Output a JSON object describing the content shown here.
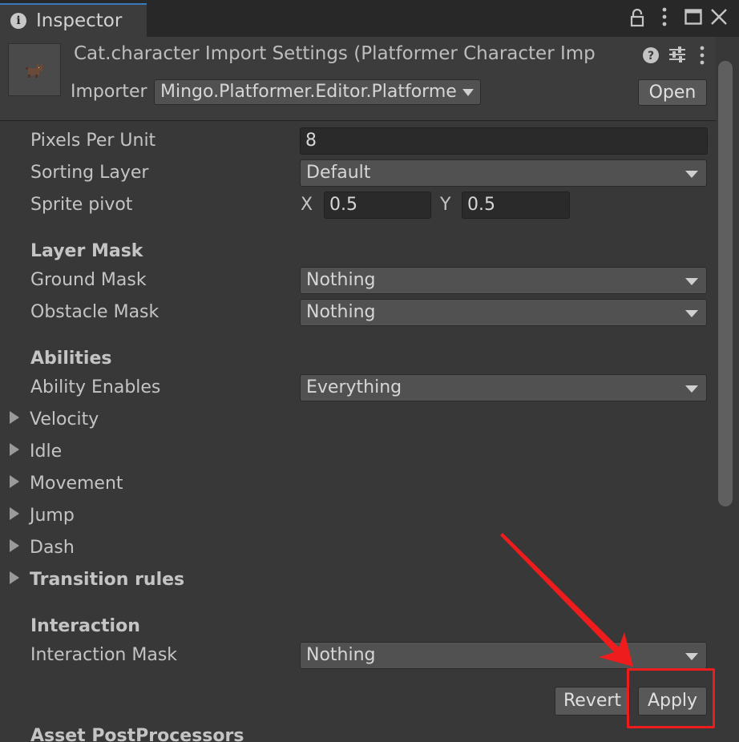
{
  "tab": {
    "title": "Inspector",
    "icon": "info-icon"
  },
  "toolbar_icons": [
    "lock-icon",
    "kebab-menu-icon",
    "maximize-icon",
    "close-icon"
  ],
  "header": {
    "title": "Cat.character Import Settings (Platformer Character Imp",
    "importer_label": "Importer",
    "importer_value": "Mingo.Platformer.Editor.Platforme",
    "open_label": "Open",
    "icons": [
      "help-icon",
      "sliders-icon",
      "kebab-menu-icon"
    ]
  },
  "properties": {
    "pixels_per_unit": {
      "label": "Pixels Per Unit",
      "value": "8"
    },
    "sorting_layer": {
      "label": "Sorting Layer",
      "value": "Default"
    },
    "sprite_pivot": {
      "label": "Sprite pivot",
      "x_label": "X",
      "x_value": "0.5",
      "y_label": "Y",
      "y_value": "0.5"
    }
  },
  "layer_mask": {
    "header": "Layer Mask",
    "ground_mask": {
      "label": "Ground Mask",
      "value": "Nothing"
    },
    "obstacle_mask": {
      "label": "Obstacle Mask",
      "value": "Nothing"
    }
  },
  "abilities": {
    "header": "Abilities",
    "ability_enables": {
      "label": "Ability Enables",
      "value": "Everything"
    },
    "foldouts": [
      "Velocity",
      "Idle",
      "Movement",
      "Jump",
      "Dash"
    ],
    "transition_rules": "Transition rules"
  },
  "interaction": {
    "header": "Interaction",
    "interaction_mask": {
      "label": "Interaction Mask",
      "value": "Nothing"
    }
  },
  "buttons": {
    "revert": "Revert",
    "apply": "Apply"
  },
  "next_section": "Asset PostProcessors",
  "colors": {
    "annotation_red": "#ee1c1c",
    "tab_accent": "#3a79bb"
  }
}
